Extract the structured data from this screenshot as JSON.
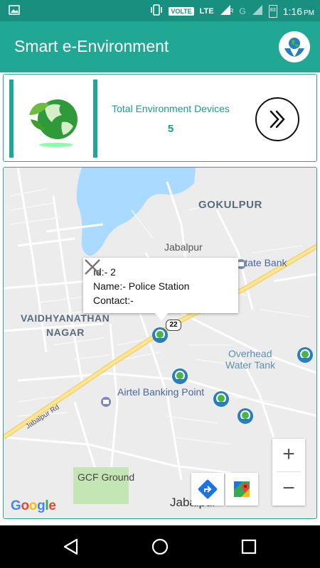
{
  "status_bar": {
    "network_badge": "VOLTE",
    "network_type": "LTE",
    "roaming": "R",
    "secondary_network": "G",
    "battery": "83",
    "time": "1:16",
    "ampm": "PM"
  },
  "app_bar": {
    "title": "Smart e-Environment",
    "accent_color": "#21a895"
  },
  "summary_card": {
    "label": "Total Environment Devices",
    "value": "5",
    "next_icon": "double-chevron-right-icon"
  },
  "map": {
    "area_labels": [
      "GOKULPUR",
      "VAIDHYANATHAN",
      "NAGAR"
    ],
    "poi_labels": [
      "Jabalpur",
      "State Bank",
      "Overhead",
      "Water Tank",
      "Airtel Banking Point"
    ],
    "road_labels": [
      "Jabalpur Rd",
      "22"
    ],
    "place_labels": [
      "GCF Ground",
      "Jabalpur"
    ],
    "popup": {
      "id_line": "Id:- 2",
      "name_line": "Name:- Police Station",
      "contact_line": "Contact:-"
    },
    "zoom_in": "+",
    "zoom_out": "−",
    "attribution": "Google",
    "device_marker_count": 5
  },
  "nav_bar": {
    "back": "back-icon",
    "home": "home-icon",
    "recents": "recents-icon"
  }
}
